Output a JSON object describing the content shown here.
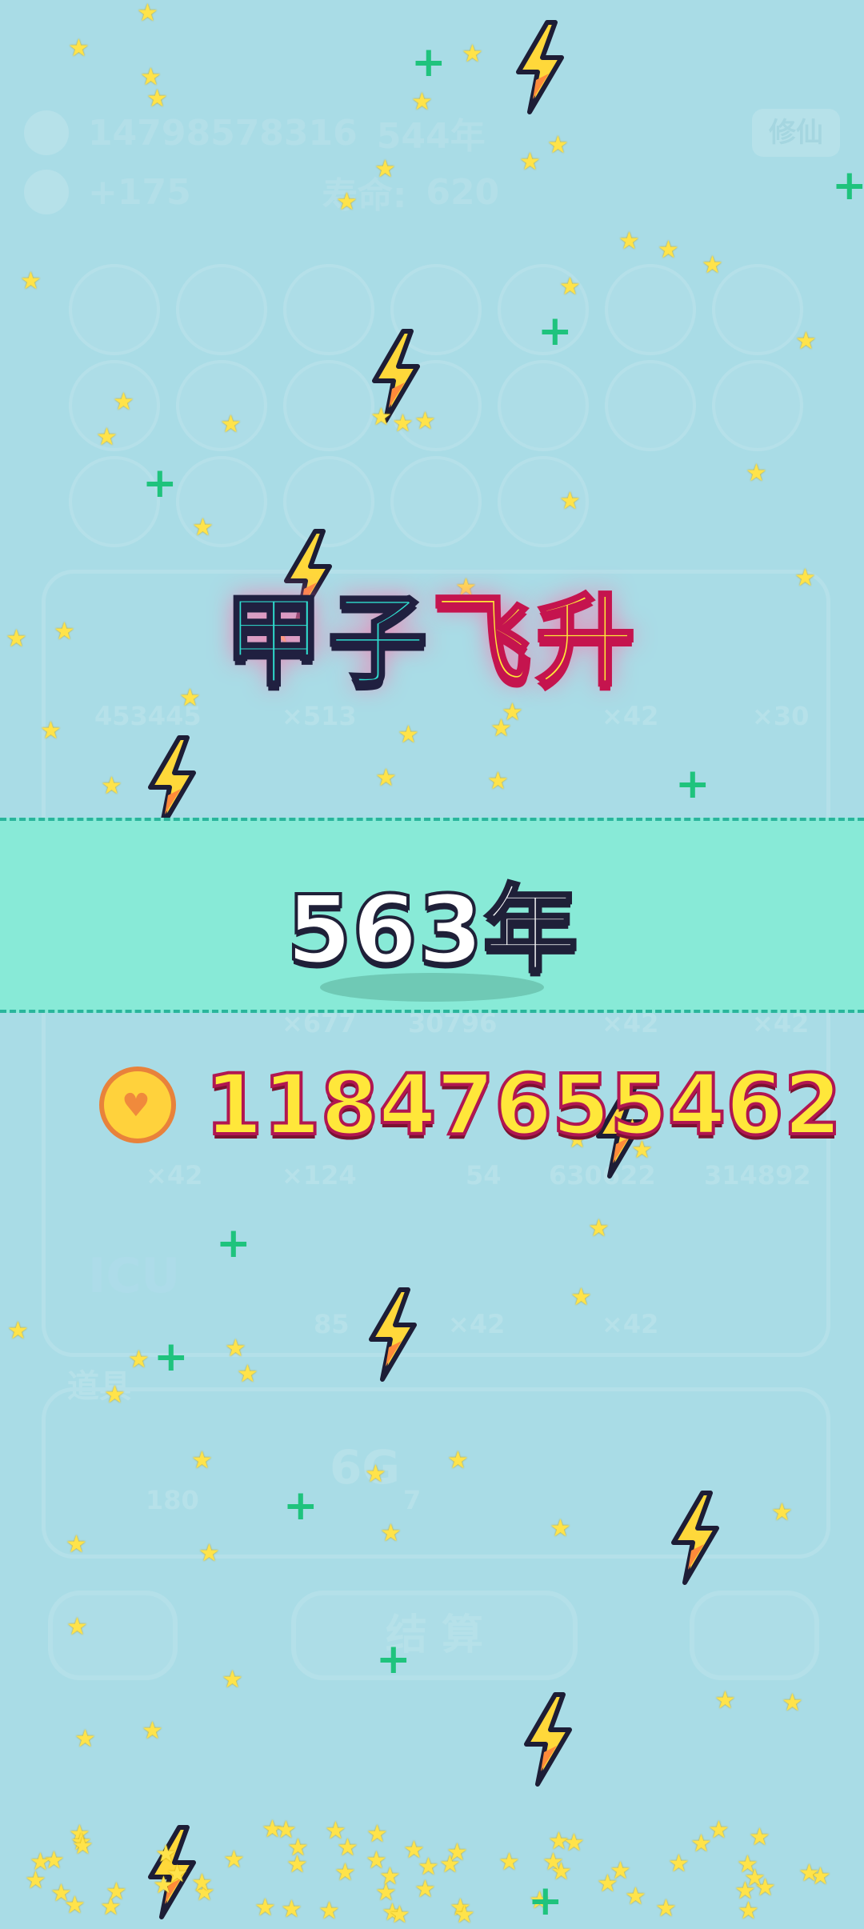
{
  "background_ui": {
    "player_id": "14798578316",
    "player_age": "544年",
    "edit_label": "修仙",
    "gain": "+175",
    "lifespan_label": "寿命:",
    "lifespan_value": "620",
    "cell_values": [
      "453445",
      "×513",
      "×42",
      "×30",
      "×677",
      "30796",
      "×42",
      "×42",
      "×42",
      "×124",
      "54",
      "630622",
      "314892",
      "85",
      "×42",
      "×42"
    ],
    "icu_label": "ICU",
    "props_title": "道具",
    "prop_values": [
      "180",
      "6G",
      "7"
    ],
    "settle_label": "结 算"
  },
  "title": {
    "part1": "甲子",
    "part2": "飞升"
  },
  "years": "563年",
  "coins": "11847655462",
  "colors": {
    "band": "#88ead7",
    "title_a": "#2fe0d1",
    "title_b": "#ffe937",
    "coin_text": "#ffe73a"
  },
  "icons": [
    "lightning-icon",
    "star-icon",
    "plus-icon",
    "heart-coin-icon"
  ]
}
